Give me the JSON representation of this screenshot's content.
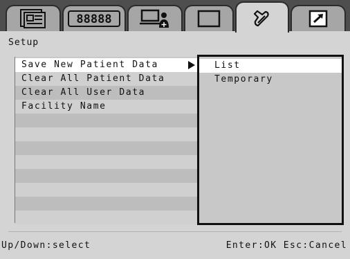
{
  "tabs": [
    {
      "icon": "patient-record-icon",
      "active": false
    },
    {
      "icon": "user-list-icon",
      "label": "88888",
      "active": false
    },
    {
      "icon": "computer-user-icon",
      "active": false
    },
    {
      "icon": "blank-window-icon",
      "active": false
    },
    {
      "icon": "wrench-settings-icon",
      "active": true
    },
    {
      "icon": "arrow-export-icon",
      "active": false
    }
  ],
  "title": "Setup",
  "menu": {
    "items": [
      {
        "label": "Save New Patient Data",
        "selected": true,
        "has_submenu": true
      },
      {
        "label": "Clear All Patient Data",
        "selected": false
      },
      {
        "label": "Clear All User Data",
        "selected": false
      },
      {
        "label": "Facility Name",
        "selected": false
      },
      {
        "label": ""
      },
      {
        "label": ""
      },
      {
        "label": ""
      },
      {
        "label": ""
      },
      {
        "label": ""
      },
      {
        "label": ""
      },
      {
        "label": ""
      },
      {
        "label": ""
      }
    ]
  },
  "submenu": {
    "items": [
      {
        "label": "List",
        "selected": true
      },
      {
        "label": "Temporary",
        "selected": false
      }
    ]
  },
  "footer": {
    "left": "Up/Down:select",
    "right": "Enter:OK Esc:Cancel"
  },
  "colors": {
    "tabbar": "#4e4e4e",
    "tab_inactive": "#a6a6a6",
    "background": "#d4d4d4",
    "selected_row": "#ffffff"
  }
}
